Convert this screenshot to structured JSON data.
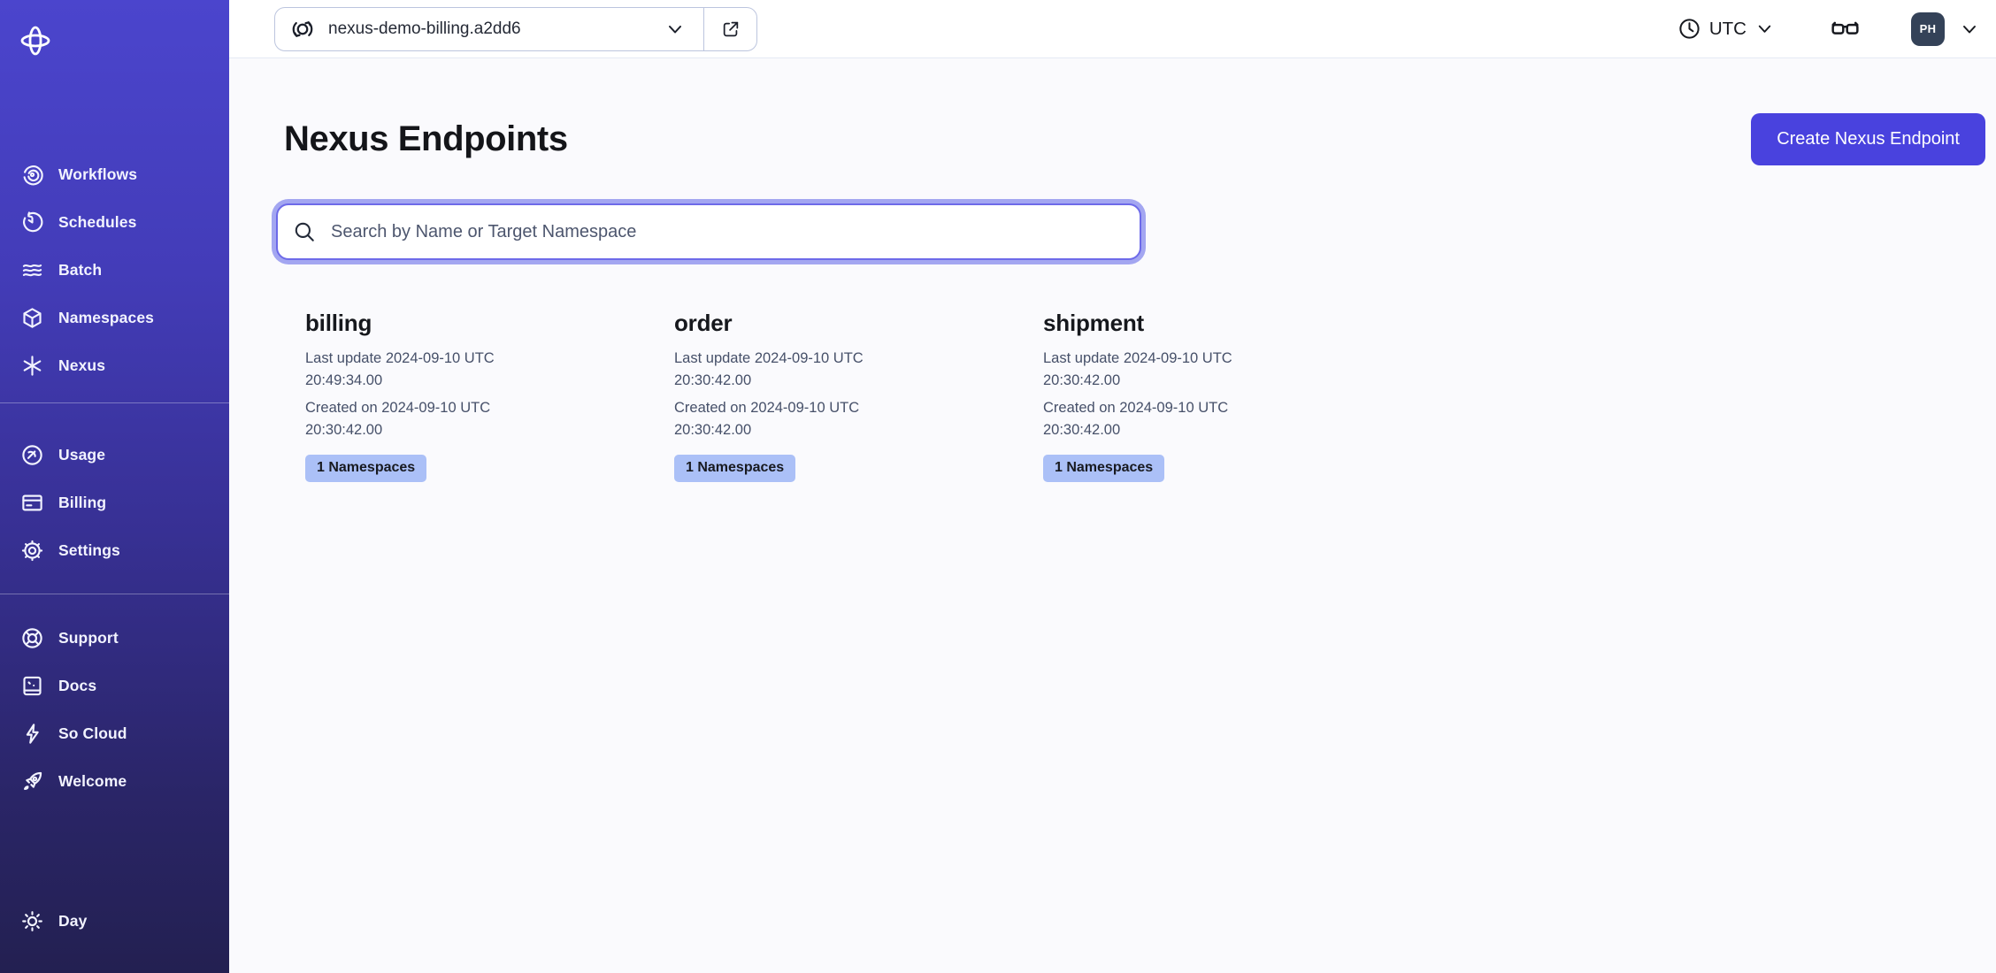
{
  "sidebar": {
    "nav_main": [
      {
        "icon": "workflows-icon",
        "label": "Workflows"
      },
      {
        "icon": "schedules-icon",
        "label": "Schedules"
      },
      {
        "icon": "batch-icon",
        "label": "Batch"
      },
      {
        "icon": "namespaces-icon",
        "label": "Namespaces"
      },
      {
        "icon": "nexus-icon",
        "label": "Nexus"
      }
    ],
    "nav_account": [
      {
        "icon": "usage-icon",
        "label": "Usage"
      },
      {
        "icon": "billing-icon",
        "label": "Billing"
      },
      {
        "icon": "settings-icon",
        "label": "Settings"
      }
    ],
    "nav_help": [
      {
        "icon": "support-icon",
        "label": "Support"
      },
      {
        "icon": "docs-icon",
        "label": "Docs"
      },
      {
        "icon": "socloud-icon",
        "label": "So Cloud"
      },
      {
        "icon": "welcome-icon",
        "label": "Welcome"
      }
    ],
    "theme": {
      "icon": "sun-icon",
      "label": "Day"
    }
  },
  "topbar": {
    "namespace_selector": {
      "value": "nexus-demo-billing.a2dd6"
    },
    "timezone": {
      "label": "UTC"
    },
    "avatar": {
      "initials": "PH"
    }
  },
  "main": {
    "title": "Nexus Endpoints",
    "create_button_label": "Create Nexus Endpoint",
    "search": {
      "placeholder": "Search by Name or Target Namespace",
      "value": ""
    },
    "endpoints": [
      {
        "name": "billing",
        "last_update_line1": "Last update 2024-09-10 UTC",
        "last_update_line2": "20:49:34.00",
        "created_line1": "Created on 2024-09-10 UTC",
        "created_line2": "20:30:42.00",
        "badge": "1 Namespaces"
      },
      {
        "name": "order",
        "last_update_line1": "Last update 2024-09-10 UTC",
        "last_update_line2": "20:30:42.00",
        "created_line1": "Created on 2024-09-10 UTC",
        "created_line2": "20:30:42.00",
        "badge": "1 Namespaces"
      },
      {
        "name": "shipment",
        "last_update_line1": "Last update 2024-09-10 UTC",
        "last_update_line2": "20:30:42.00",
        "created_line1": "Created on 2024-09-10 UTC",
        "created_line2": "20:30:42.00",
        "badge": "1 Namespaces"
      }
    ]
  },
  "colors": {
    "accent": "#4942de",
    "sidebar_gradient_top": "#4b45cd",
    "sidebar_gradient_bottom": "#232051",
    "badge_bg": "#abc0f7",
    "badge_text": "#181a20",
    "avatar_bg": "#344258",
    "focus_ring": "#a3a6f1",
    "page_bg": "#fafafd",
    "topbar_bg": "#ffffff"
  }
}
